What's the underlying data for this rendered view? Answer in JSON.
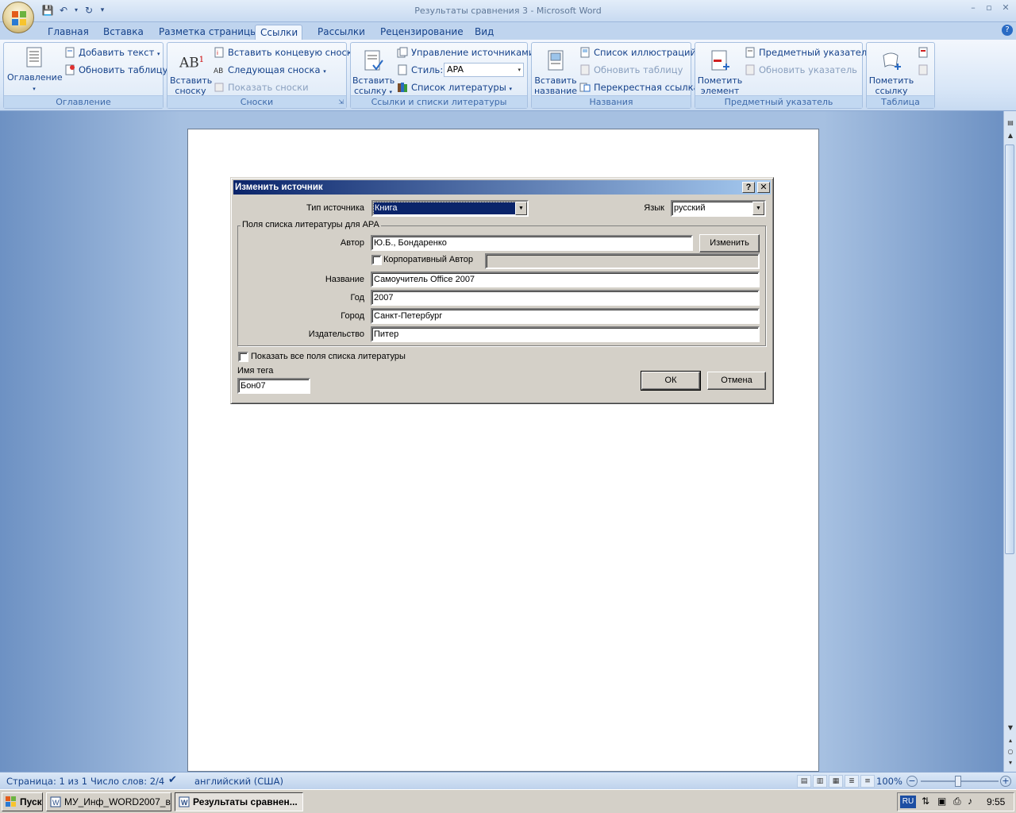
{
  "window": {
    "title": "Результаты сравнения 3 - Microsoft Word",
    "controls": [
      "–",
      "▫",
      "✕"
    ]
  },
  "tabs": [
    {
      "label": "Главная"
    },
    {
      "label": "Вставка"
    },
    {
      "label": "Разметка страницы"
    },
    {
      "label": "Ссылки",
      "active": true
    },
    {
      "label": "Рассылки"
    },
    {
      "label": "Рецензирование"
    },
    {
      "label": "Вид"
    }
  ],
  "ribbon": {
    "toc": {
      "group_label": "Оглавление",
      "big_label": "Оглавление",
      "add_text": "Добавить текст",
      "update_table": "Обновить таблицу"
    },
    "footnotes": {
      "group_label": "Сноски",
      "big_label_1": "Вставить",
      "big_label_2": "сноску",
      "insert_endnote": "Вставить концевую сноску",
      "next_footnote": "Следующая сноска",
      "show_notes": "Показать сноски"
    },
    "citations": {
      "group_label": "Ссылки и списки литературы",
      "big_label_1": "Вставить",
      "big_label_2": "ссылку",
      "manage_sources": "Управление источниками",
      "style_label": "Стиль:",
      "style_value": "APA",
      "bibliography": "Список литературы"
    },
    "captions": {
      "group_label": "Названия",
      "big_label_1": "Вставить",
      "big_label_2": "название",
      "list_of_figures": "Список иллюстраций",
      "update_table": "Обновить таблицу",
      "cross_reference": "Перекрестная ссылка"
    },
    "index": {
      "group_label": "Предметный указатель",
      "big_label_1": "Пометить",
      "big_label_2": "элемент",
      "insert_index": "Предметный указатель",
      "update_index": "Обновить указатель"
    },
    "toa": {
      "group_label": "Таблица ссылок",
      "big_label_1": "Пометить",
      "big_label_2": "ссылку"
    }
  },
  "dialog": {
    "title": "Изменить источник",
    "help_btn": "?",
    "close_btn": "✕",
    "source_type_label": "Тип источника",
    "source_type_value": "Книга",
    "language_label": "Язык",
    "language_value": "русский",
    "fieldset_legend": "Поля списка литературы для APA",
    "author_label": "Автор",
    "author_value": "Ю.Б., Бондаренко",
    "edit_button": "Изменить",
    "corporate_author_label": "Корпоративный Автор",
    "title_label": "Название",
    "title_value": "Самоучитель Office 2007",
    "year_label": "Год",
    "year_value": "2007",
    "city_label": "Город",
    "city_value": "Санкт-Петербург",
    "publisher_label": "Издательство",
    "publisher_value": "Питер",
    "show_all_fields_label": "Показать все поля списка литературы",
    "tag_name_label": "Имя тега",
    "tag_name_value": "Бон07",
    "ok_button": "ОК",
    "cancel_button": "Отмена"
  },
  "statusbar": {
    "page": "Страница: 1 из 1",
    "words": "Число слов: 2/4",
    "language": "английский (США)",
    "zoom": "100%"
  },
  "taskbar": {
    "start": "Пуск",
    "task1": "МУ_Инф_WORD2007_в...",
    "task2": "Результаты сравнен...",
    "lang": "RU",
    "clock": "9:55"
  },
  "colors": {
    "accent": "#15428b",
    "dialog_title_start": "#0a246a",
    "dialog_title_end": "#a6caf0"
  }
}
